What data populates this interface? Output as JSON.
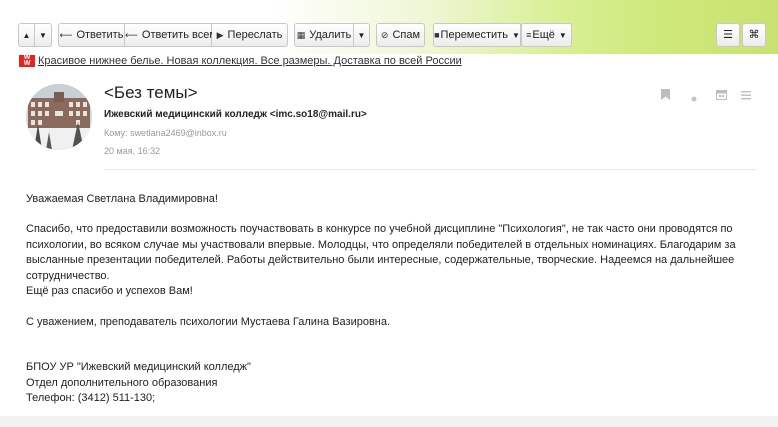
{
  "toolbar": {
    "up_arrow": "▲",
    "down_arrow": "▼",
    "reply": "Ответить",
    "reply_all": "Ответить всем",
    "forward": "Переслать",
    "delete": "Удалить",
    "spam": "Спам",
    "move": "Переместить",
    "more": "Ещё"
  },
  "ad": {
    "icon_text": "WO WO",
    "text": "Красивое нижнее белье. Новая коллекция. Все размеры. Доставка по всей России"
  },
  "message": {
    "subject": "<Без темы>",
    "from": "Ижевский медицинский колледж <imc.so18@mail.ru>",
    "to_label": "Кому:",
    "to": "swetlana2469@inbox.ru",
    "date": "20 мая, 16:32"
  },
  "body": {
    "greeting": "Уважаемая Светлана Владимировна!",
    "para1_lines": [
      "Спасибо, что предоставили возможность поучаствовать в конкурсе по учебной дисциплине \"Психология\", не так часто они проводятся по",
      "психологии, во всяком случае мы участвовали впервые. Молодцы, что определяли победителей в отдельных номинациях. Благодарим за",
      "высланные презентации победителей. Работы действительно были интересные, содержательные, творческие. Надеемся на дальнейшее",
      "сотрудничество.",
      "Ещё раз спасибо и успехов Вам!"
    ],
    "regards": "С уважением, преподаватель психологии Мустаева Галина Вазировна.",
    "signature": [
      "БПОУ УР \"Ижевский медицинский колледж\"",
      "Отдел дополнительного образования",
      "Телефон: (3412) 511-130;"
    ]
  },
  "colors": {
    "toolbar_gradient_end": "#c9e26f",
    "ad_icon": "#e2261f"
  }
}
